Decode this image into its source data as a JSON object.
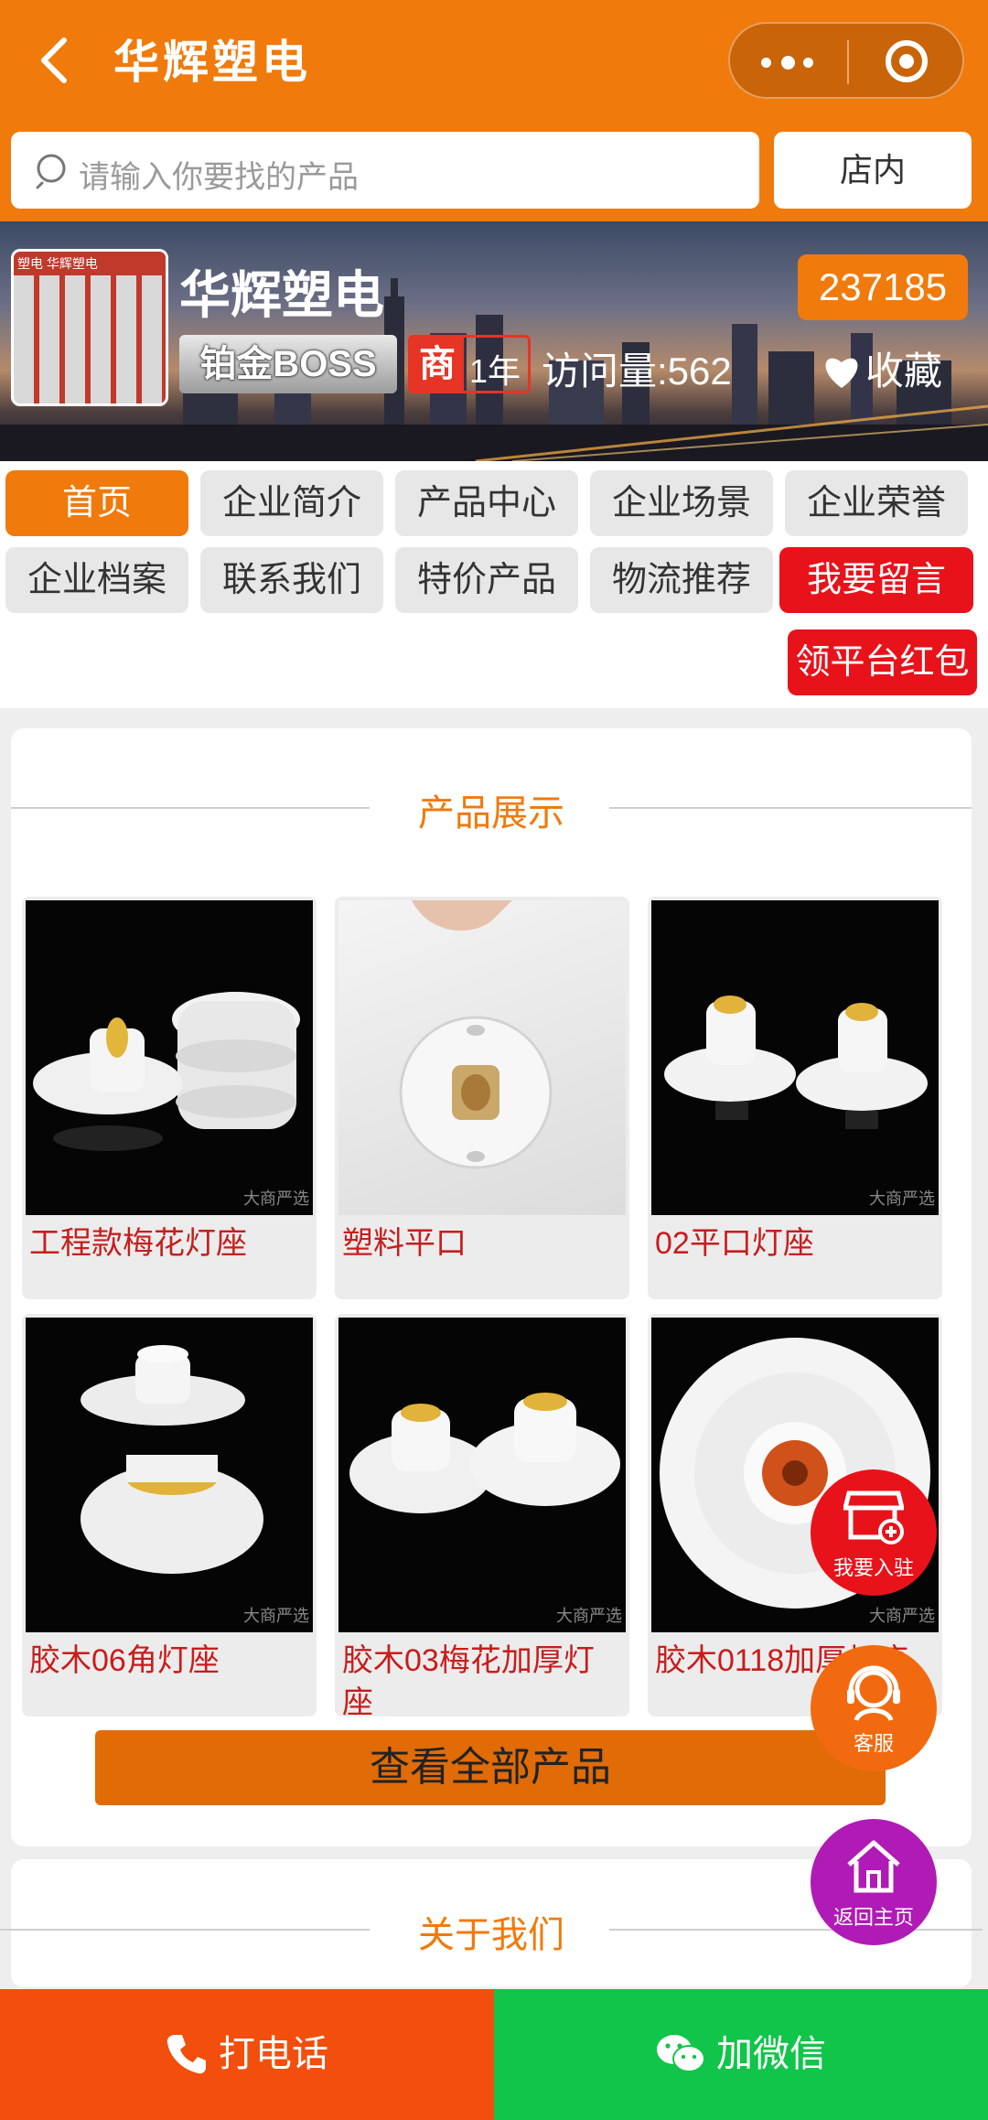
{
  "header": {
    "title": "华辉塑电"
  },
  "search": {
    "placeholder": "请输入你要找的产品",
    "scope_button": "店内"
  },
  "shop": {
    "name": "华辉塑电",
    "phone_tail": "237185",
    "level_badge": "铂金BOSS",
    "merchant_badge": "商",
    "years": "1年",
    "visits": "访问量:562",
    "favorite": "收藏",
    "logo_text": "塑电 华辉塑电"
  },
  "nav": {
    "items": [
      "首页",
      "企业简介",
      "产品中心",
      "企业场景",
      "企业荣誉",
      "企业档案",
      "联系我们",
      "特价产品",
      "物流推荐",
      "我要留言"
    ],
    "active": "首页",
    "red_packet": "领平台红包"
  },
  "products_section": {
    "title": "产品展示",
    "watermark": "大商严选",
    "items": [
      {
        "name": "工程款梅花灯座"
      },
      {
        "name": "塑料平口"
      },
      {
        "name": "02平口灯座"
      },
      {
        "name": "胶木06角灯座"
      },
      {
        "name": "胶木03梅花加厚灯座"
      },
      {
        "name": "胶木0118加厚灯座"
      }
    ],
    "view_all": "查看全部产品"
  },
  "about_section": {
    "title": "关于我们"
  },
  "floating": {
    "join": "我要入驻",
    "service": "客服",
    "home": "返回主页"
  },
  "bottom_bar": {
    "call": "打电话",
    "wechat": "加微信"
  },
  "colors": {
    "brand_orange": "#f07a0c",
    "red": "#e8121b",
    "green": "#10c549",
    "product_name": "#c81d1d"
  }
}
